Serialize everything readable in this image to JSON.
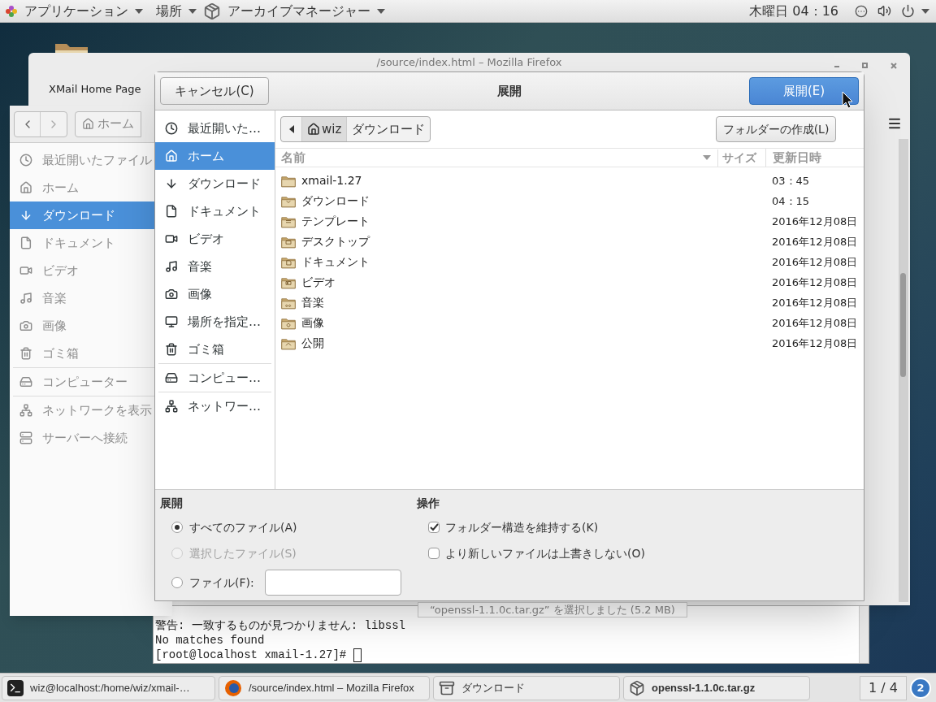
{
  "top_bar": {
    "menus": [
      {
        "label": "アプリケーション"
      },
      {
        "label": "場所"
      },
      {
        "label": "アーカイブマネージャー"
      }
    ],
    "clock": "木曜日 04：16"
  },
  "browser_window": {
    "title": "/source/index.html – Mozilla Firefox",
    "tab_label": "XMail Home Page"
  },
  "files_window": {
    "path": [
      {
        "label": "ホーム"
      }
    ],
    "sidebar": [
      {
        "items": [
          {
            "label": "最近開いたファイル",
            "selected": false
          },
          {
            "label": "ホーム",
            "selected": false
          },
          {
            "label": "ダウンロード",
            "selected": true
          },
          {
            "label": "ドキュメント",
            "selected": false
          },
          {
            "label": "ビデオ",
            "selected": false
          },
          {
            "label": "音楽",
            "selected": false
          },
          {
            "label": "画像",
            "selected": false
          },
          {
            "label": "ゴミ箱",
            "selected": false
          }
        ]
      },
      {
        "items": [
          {
            "label": "コンピューター",
            "selected": false
          }
        ]
      },
      {
        "items": [
          {
            "label": "ネットワークを表示",
            "selected": false
          },
          {
            "label": "サーバーへ接続",
            "selected": false
          }
        ]
      }
    ]
  },
  "terminal": {
    "lines": [
      "警告: 一致するものが見つかりません: libssl",
      "No matches found",
      "[root@localhost xmail-1.27]#"
    ]
  },
  "dialog": {
    "title": "展開",
    "cancel_button": "キャンセル(C)",
    "confirm_button": "展開(E)",
    "sidebar": [
      {
        "items": [
          {
            "label": "最近開いた…",
            "selected": false
          },
          {
            "label": "ホーム",
            "selected": true
          },
          {
            "label": "ダウンロード",
            "selected": false
          },
          {
            "label": "ドキュメント",
            "selected": false
          },
          {
            "label": "ビデオ",
            "selected": false
          },
          {
            "label": "音楽",
            "selected": false
          },
          {
            "label": "画像",
            "selected": false
          },
          {
            "label": "場所を指定…",
            "selected": false
          },
          {
            "label": "ゴミ箱",
            "selected": false
          }
        ]
      },
      {
        "items": [
          {
            "label": "コンピュー…",
            "selected": false
          }
        ]
      },
      {
        "items": [
          {
            "label": "ネットワー…",
            "selected": false
          }
        ]
      }
    ],
    "path": [
      {
        "label": "wiz",
        "selected": true
      },
      {
        "label": "ダウンロード",
        "selected": false
      }
    ],
    "create_folder_button": "フォルダーの作成(L)",
    "columns": [
      "名前",
      "サイズ",
      "更新日時"
    ],
    "rows": [
      {
        "name": "xmail-1.27",
        "modified": "03：45"
      },
      {
        "name": "ダウンロード",
        "modified": "04：15"
      },
      {
        "name": "テンプレート",
        "modified": "2016年12月08日"
      },
      {
        "name": "デスクトップ",
        "modified": "2016年12月08日"
      },
      {
        "name": "ドキュメント",
        "modified": "2016年12月08日"
      },
      {
        "name": "ビデオ",
        "modified": "2016年12月08日"
      },
      {
        "name": "音楽",
        "modified": "2016年12月08日"
      },
      {
        "name": "画像",
        "modified": "2016年12月08日"
      },
      {
        "name": "公開",
        "modified": "2016年12月08日"
      }
    ],
    "extract": {
      "title": "展開",
      "options": [
        {
          "label": "すべてのファイル(A)",
          "selected": true,
          "disabled": false
        },
        {
          "label": "選択したファイル(S)",
          "selected": false,
          "disabled": true
        },
        {
          "label": "ファイル(F):",
          "selected": false,
          "disabled": false
        }
      ]
    },
    "actions": {
      "title": "操作",
      "options": [
        {
          "label": "フォルダー構造を維持する(K)",
          "checked": true
        },
        {
          "label": "より新しいファイルは上書きしない(O)",
          "checked": false
        }
      ]
    }
  },
  "tooltip": "“openssl-1.1.0c.tar.gz” を選択しました (5.2 MB)",
  "taskbar": {
    "items": [
      {
        "label": "wiz@localhost:/home/wiz/xmail-…"
      },
      {
        "label": "/source/index.html – Mozilla Firefox"
      },
      {
        "label": "ダウンロード"
      },
      {
        "label": "openssl-1.1.0c.tar.gz"
      }
    ],
    "pager": "1 / 4",
    "notification_count": "2"
  }
}
